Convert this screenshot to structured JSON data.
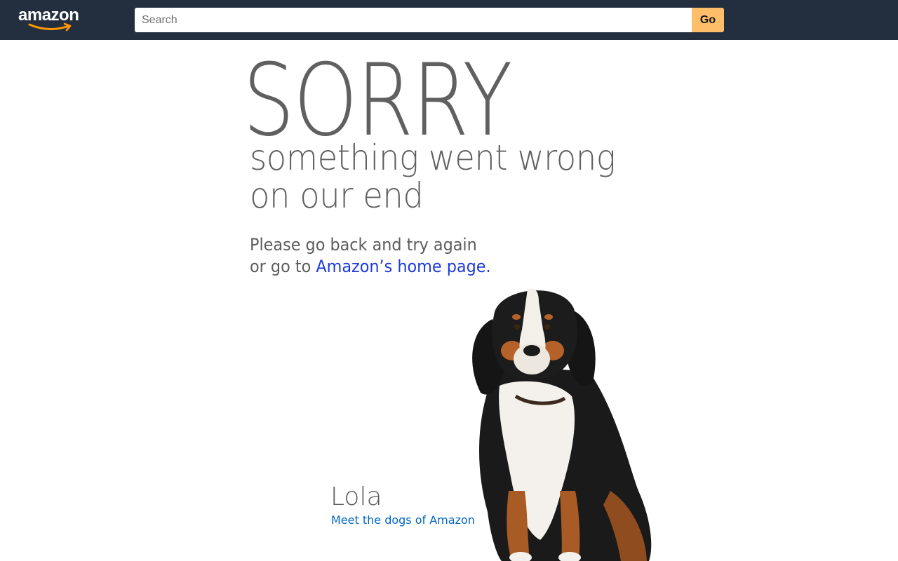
{
  "header": {
    "logo_text": "amazon",
    "search_placeholder": "Search",
    "search_value": "",
    "go_label": "Go"
  },
  "error": {
    "headline": "SORRY",
    "subtitle_line1": "something went wrong",
    "subtitle_line2": "on our end",
    "instruction_line1": "Please go back and try again",
    "instruction_line2_prefix": "or go to ",
    "home_link_label": "Amazon’s home page."
  },
  "dog": {
    "name": "Lola",
    "link_label": "Meet the dogs of Amazon"
  },
  "colors": {
    "header_bg": "#232f3e",
    "go_button": "#febd69",
    "logo_smile": "#ff9900",
    "link": "#0066c0",
    "home_link": "#1d3bd9"
  }
}
